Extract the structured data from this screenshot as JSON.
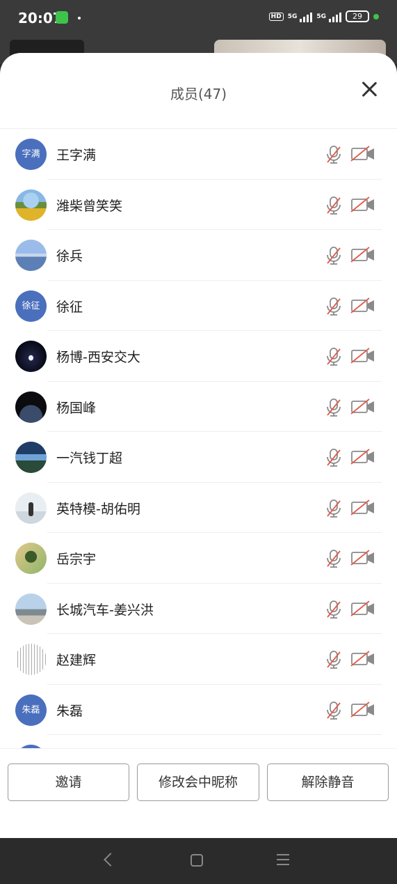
{
  "status_bar": {
    "time": "20:07",
    "network_labels": [
      "HD",
      "5G",
      "5G"
    ],
    "battery": "29"
  },
  "sheet": {
    "title": "成员(47)"
  },
  "members": [
    {
      "name": "王字满",
      "avatar_text": "字满"
    },
    {
      "name": "潍柴曾笑笑",
      "avatar_text": ""
    },
    {
      "name": "徐兵",
      "avatar_text": ""
    },
    {
      "name": "徐征",
      "avatar_text": "徐征"
    },
    {
      "name": "杨博-西安交大",
      "avatar_text": ""
    },
    {
      "name": "杨国峰",
      "avatar_text": ""
    },
    {
      "name": "一汽钱丁超",
      "avatar_text": ""
    },
    {
      "name": "英特模-胡佑明",
      "avatar_text": ""
    },
    {
      "name": "岳宗宇",
      "avatar_text": ""
    },
    {
      "name": "长城汽车-姜兴洪",
      "avatar_text": ""
    },
    {
      "name": "赵建辉",
      "avatar_text": ""
    },
    {
      "name": "朱磊",
      "avatar_text": "朱磊"
    }
  ],
  "footer": {
    "invite": "邀请",
    "rename": "修改会中昵称",
    "unmute": "解除静音"
  },
  "colors": {
    "accent_blue": "#4a6fbd",
    "muted_red": "#e05a4a",
    "icon_gray": "#8a8a8a"
  }
}
